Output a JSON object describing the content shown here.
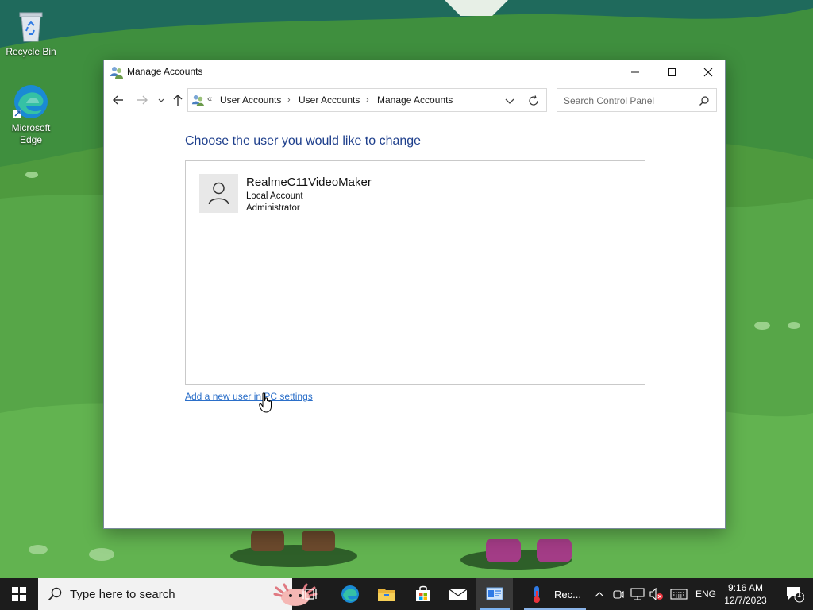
{
  "desktop": {
    "icons": [
      {
        "label": "Recycle Bin",
        "icon": "recycle-bin-icon"
      },
      {
        "label": "Microsoft Edge",
        "icon": "edge-icon"
      }
    ]
  },
  "window": {
    "title": "Manage Accounts",
    "controls": {
      "minimize": "minimize-icon",
      "maximize": "maximize-icon",
      "close": "close-icon"
    },
    "nav": {
      "back": "back-arrow-icon",
      "forward": "forward-arrow-icon",
      "recent": "chevron-down-icon",
      "up": "up-arrow-icon"
    },
    "address": {
      "overflow": "«",
      "crumbs": [
        "User Accounts",
        "User Accounts",
        "Manage Accounts"
      ]
    },
    "search": {
      "placeholder": "Search Control Panel"
    },
    "heading": "Choose the user you would like to change",
    "users": [
      {
        "name": "RealmeC11VideoMaker",
        "type": "Local Account",
        "role": "Administrator"
      }
    ],
    "add_user_link": "Add a new user in PC settings"
  },
  "taskbar": {
    "search_placeholder": "Type here to search",
    "pinned": [
      "task-view-icon",
      "edge-icon",
      "file-explorer-icon",
      "microsoft-store-icon",
      "mail-icon",
      "control-panel-icon"
    ],
    "running_label": "Rec...",
    "language": "ENG",
    "time": "9:16 AM",
    "date": "12/7/2023",
    "notification_count": "1"
  },
  "colors": {
    "heading": "#1e3f8c",
    "link": "#2b6fc9",
    "taskbar": "#1c1c1c",
    "accent": "#7db4f2"
  }
}
